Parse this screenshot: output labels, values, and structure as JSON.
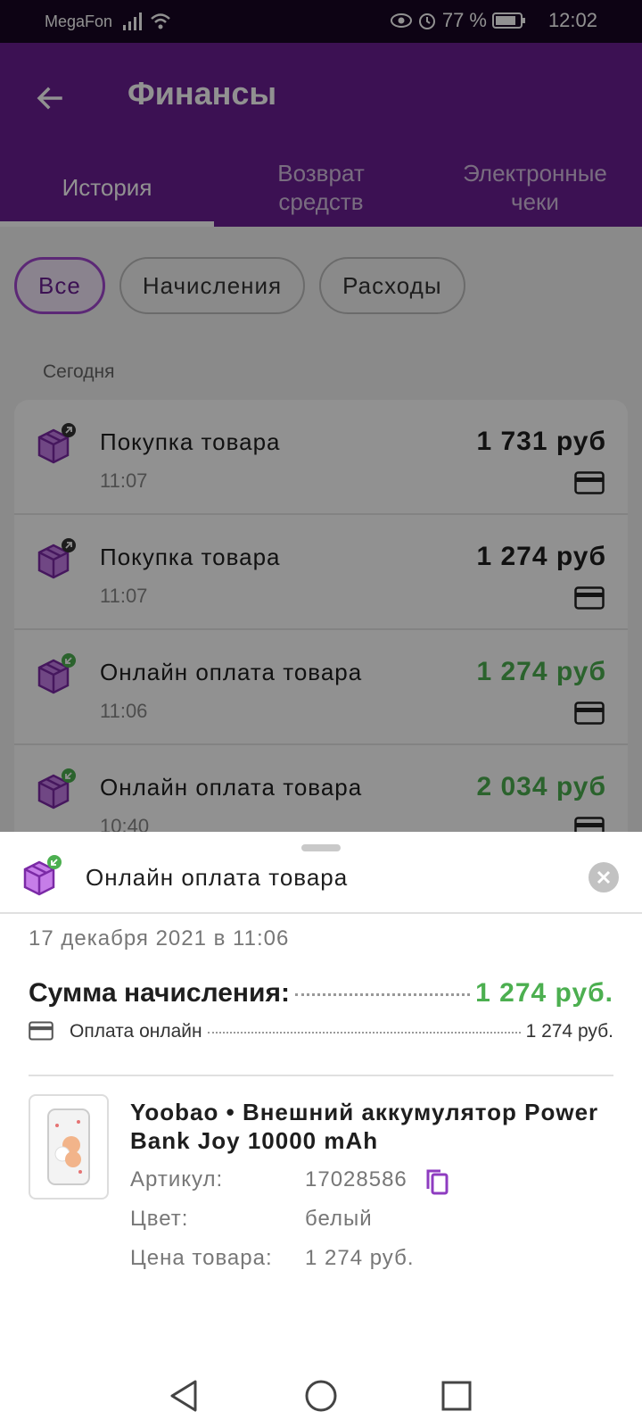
{
  "status_bar": {
    "carrier": "MegaFon",
    "battery_text": "77 %",
    "time": "12:02",
    "icons": [
      "signal-icon",
      "wifi-icon",
      "eye-icon",
      "alarm-icon",
      "battery-icon"
    ]
  },
  "header": {
    "title": "Финансы",
    "back_icon": "arrow-left-icon"
  },
  "tabs": [
    {
      "label": "История",
      "active": true
    },
    {
      "label": "Возврат\nсредств",
      "active": false
    },
    {
      "label": "Электронные\nчеки",
      "active": false
    }
  ],
  "filters": [
    {
      "label": "Все",
      "active": true
    },
    {
      "label": "Начисления",
      "active": false
    },
    {
      "label": "Расходы",
      "active": false
    }
  ],
  "section_label": "Сегодня",
  "transactions": [
    {
      "title": "Покупка товара",
      "time": "11:07",
      "amount": "1 731 руб",
      "type": "expense",
      "icon": "package-outgoing-icon"
    },
    {
      "title": "Покупка товара",
      "time": "11:07",
      "amount": "1 274 руб",
      "type": "expense",
      "icon": "package-outgoing-icon"
    },
    {
      "title": "Онлайн оплата товара",
      "time": "11:06",
      "amount": "1 274 руб",
      "type": "income",
      "icon": "package-incoming-icon"
    },
    {
      "title": "Онлайн оплата товара",
      "time": "10:40",
      "amount": "2 034 руб",
      "type": "income",
      "icon": "package-incoming-icon"
    }
  ],
  "sheet": {
    "title": "Онлайн оплата товара",
    "date": "17 декабря 2021 в 11:06",
    "sum_label": "Сумма начисления:",
    "sum_value": "1 274 руб.",
    "payment_label": "Оплата онлайн",
    "payment_value": "1 274 руб.",
    "product": {
      "name": "Yoobao • Внешний аккумулятор Power Bank Joy 10000 mAh",
      "article_label": "Артикул:",
      "article_value": "17028586",
      "color_label": "Цвет:",
      "color_value": "белый",
      "price_label": "Цена товара:",
      "price_value": "1 274 руб."
    }
  },
  "colors": {
    "brand": "#6a1f92",
    "accent": "#a347d0",
    "income": "#4caf50",
    "status_bar": "#170624"
  }
}
